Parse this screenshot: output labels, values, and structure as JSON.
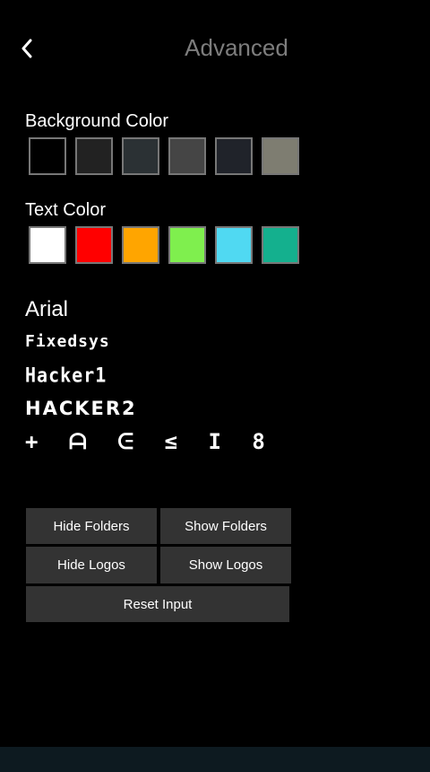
{
  "header": {
    "back_icon": "chevron-left-icon",
    "title": "Advanced"
  },
  "background_color": {
    "label": "Background Color",
    "swatches": [
      "#000000",
      "#222222",
      "#2b3134",
      "#454545",
      "#20232a",
      "#7e7d71"
    ]
  },
  "text_color": {
    "label": "Text Color",
    "swatches": [
      "#ffffff",
      "#ff0000",
      "#ffa500",
      "#7fef4e",
      "#50d9f2",
      "#14b08e"
    ]
  },
  "fonts": [
    "Arial",
    "Fixedsys",
    "Hacker1",
    "HACKER2",
    "+ ᗩ ᕮ ≤ I 8"
  ],
  "buttons": {
    "hide_folders": "Hide Folders",
    "show_folders": "Show Folders",
    "hide_logos": "Hide Logos",
    "show_logos": "Show Logos",
    "reset_input": "Reset Input"
  }
}
